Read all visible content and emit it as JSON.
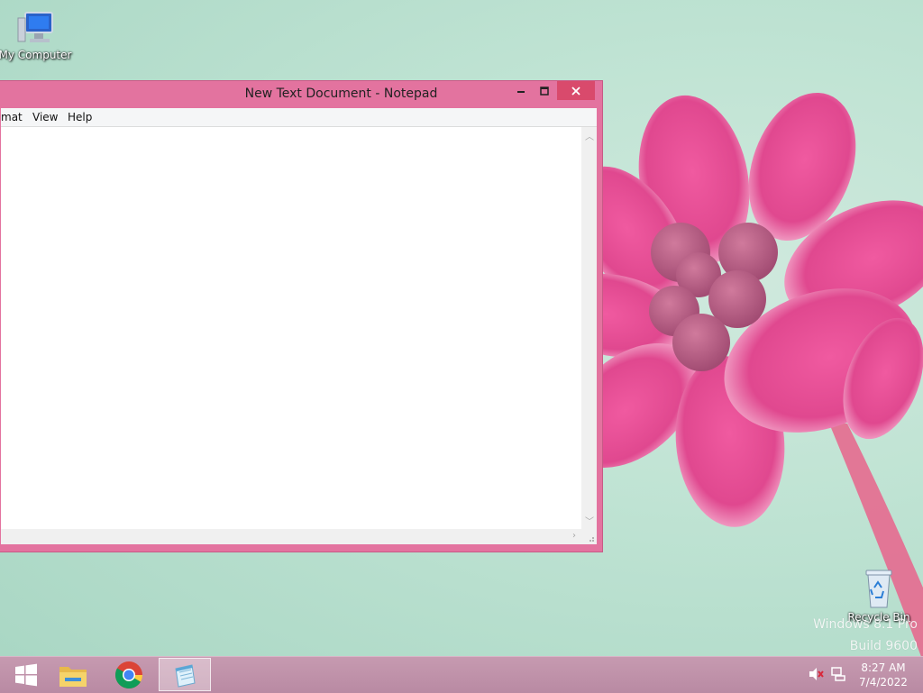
{
  "desktop": {
    "icons": [
      {
        "label": "My Computer",
        "icon": "computer-icon"
      },
      {
        "label": "Recycle Bin",
        "icon": "recycle-bin-icon"
      }
    ],
    "watermark": {
      "line1": "Windows 8.1 Pro",
      "line2": "Build 9600"
    }
  },
  "notepad": {
    "title": "New Text Document - Notepad",
    "menu": [
      "mat",
      "View",
      "Help"
    ],
    "content": ""
  },
  "taskbar": {
    "apps": [
      {
        "name": "start",
        "icon": "windows-logo-icon"
      },
      {
        "name": "file-explorer",
        "icon": "folder-icon"
      },
      {
        "name": "chrome",
        "icon": "chrome-icon"
      },
      {
        "name": "notepad",
        "icon": "notepad-icon",
        "active": true
      }
    ],
    "tray": {
      "icons": [
        "speaker-muted-icon",
        "network-icon"
      ],
      "time": "8:27 AM",
      "date": "7/4/2022"
    }
  },
  "colors": {
    "window_frame": "#e3739f",
    "close_button": "#d94a6c",
    "taskbar": "#c69ab0",
    "desktop": "#bfe3d3"
  }
}
